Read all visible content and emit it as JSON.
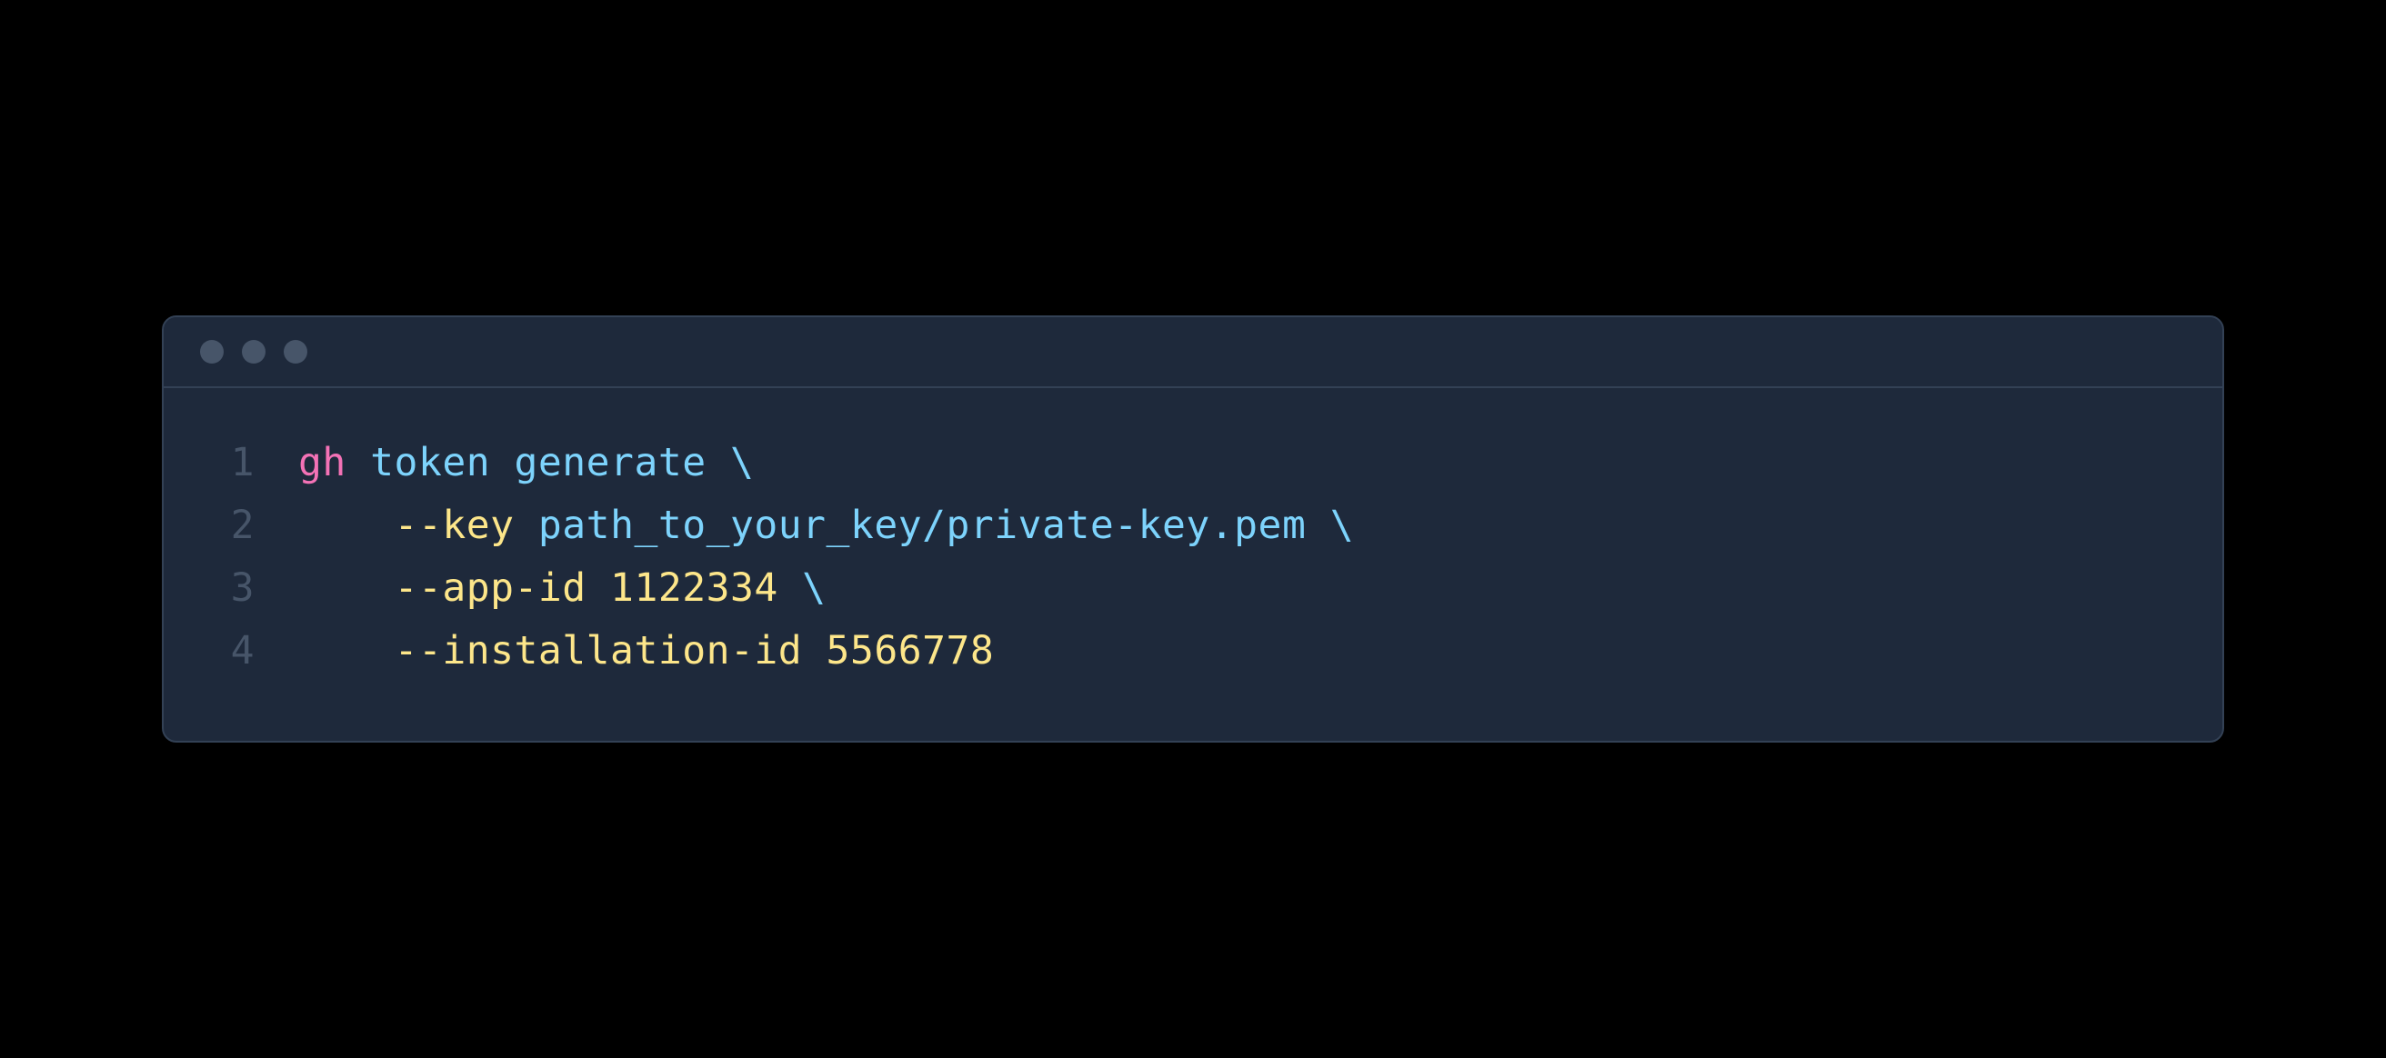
{
  "code": {
    "lines": [
      {
        "num": "1",
        "indent": "",
        "tokens": [
          {
            "cls": "tok-cmd",
            "text": "gh"
          },
          {
            "cls": "tok-arg",
            "text": " token generate "
          },
          {
            "cls": "tok-cont",
            "text": "\\"
          }
        ]
      },
      {
        "num": "2",
        "indent": "    ",
        "tokens": [
          {
            "cls": "tok-flag",
            "text": "--key"
          },
          {
            "cls": "tok-val",
            "text": " path_to_your_key/private-key.pem "
          },
          {
            "cls": "tok-cont",
            "text": "\\"
          }
        ]
      },
      {
        "num": "3",
        "indent": "    ",
        "tokens": [
          {
            "cls": "tok-flag",
            "text": "--app-id"
          },
          {
            "cls": "tok-num",
            "text": " 1122334 "
          },
          {
            "cls": "tok-cont",
            "text": "\\"
          }
        ]
      },
      {
        "num": "4",
        "indent": "    ",
        "tokens": [
          {
            "cls": "tok-flag",
            "text": "--installation-id"
          },
          {
            "cls": "tok-num",
            "text": " 5566778"
          }
        ]
      }
    ]
  }
}
